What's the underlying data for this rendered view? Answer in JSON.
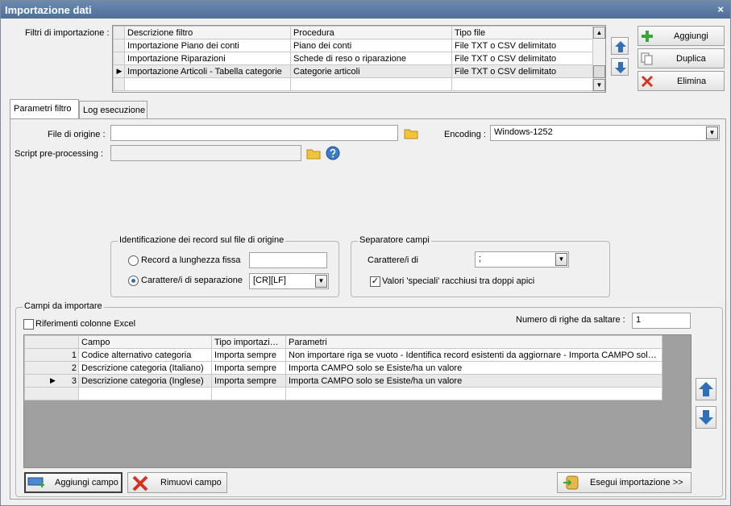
{
  "window": {
    "title": "Importazione dati",
    "close": "×"
  },
  "filters": {
    "label": "Filtri di importazione :",
    "columns": [
      "Descrizione filtro",
      "Procedura",
      "Tipo file"
    ],
    "rows": [
      [
        "Importazione Piano dei conti",
        "Piano dei conti",
        "File TXT o CSV delimitato"
      ],
      [
        "Importazione Riparazioni",
        "Schede di reso o riparazione",
        "File TXT o CSV delimitato"
      ],
      [
        "Importazione Articoli - Tabella categorie",
        "Categorie articoli",
        "File TXT o CSV delimitato"
      ]
    ],
    "current_marker": "▶"
  },
  "actions": {
    "add": "Aggiungi",
    "duplicate": "Duplica",
    "delete": "Elimina"
  },
  "tabs": [
    "Parametri filtro",
    "Log esecuzione"
  ],
  "params": {
    "source_file_label": "File di origine :",
    "source_file_value": "",
    "encoding_label": "Encoding :",
    "encoding_value": "Windows-1252",
    "script_label": "Script pre-processing :",
    "script_value": ""
  },
  "record_id": {
    "title": "Identificazione dei record sul file di origine",
    "fixed_label": "Record a lunghezza fissa",
    "fixed_value": "",
    "sep_label": "Carattere/i di separazione",
    "sep_value": "[CR][LF]"
  },
  "field_sep": {
    "title": "Separatore campi",
    "chars_label": "Carattere/i di",
    "chars_value": ";",
    "special_label": "Valori 'speciali' racchiusi tra doppi apici",
    "special_checked": "✓"
  },
  "fields": {
    "title": "Campi da importare",
    "excel_label": "Riferimenti colonne Excel",
    "skip_label": "Numero di righe da saltare  :",
    "skip_value": "1",
    "columns": [
      "Campo",
      "Tipo importazione",
      "Parametri"
    ],
    "rows": [
      [
        "1",
        "Codice alternativo categoria",
        "Importa sempre",
        "Non importare riga se vuoto - Identifica record esistenti da aggiornare - Importa CAMPO solo se Esiste/ha un valore"
      ],
      [
        "2",
        "Descrizione categoria (Italiano)",
        "Importa sempre",
        "Importa CAMPO solo se Esiste/ha un valore"
      ],
      [
        "3",
        "Descrizione categoria (Inglese)",
        "Importa sempre",
        "Importa CAMPO solo se Esiste/ha un valore"
      ]
    ],
    "current_marker": "▶"
  },
  "bottom": {
    "add_field": "Aggiungi campo",
    "remove_field": "Rimuovi campo",
    "run": "Esegui importazione >>"
  },
  "colors": {
    "title_bar": "#5a7aa3",
    "up_down_arrow": "#2f6fb8",
    "delete_x": "#d8311e",
    "add_plus": "#3aa63a"
  }
}
